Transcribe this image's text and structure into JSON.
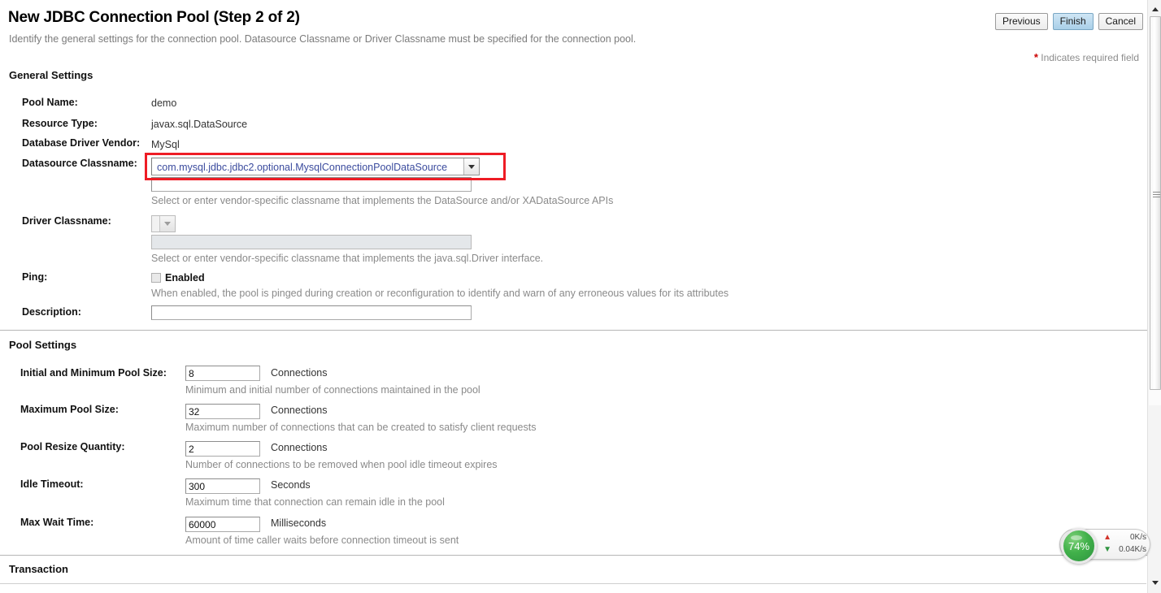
{
  "header": {
    "title": "New JDBC Connection Pool (Step 2 of 2)",
    "subtitle": "Identify the general settings for the connection pool. Datasource Classname or Driver Classname must be specified for the connection pool.",
    "required_star": "*",
    "required_note": "Indicates required field"
  },
  "buttons": {
    "previous": "Previous",
    "finish": "Finish",
    "cancel": "Cancel"
  },
  "sections": {
    "general": "General Settings",
    "pool": "Pool Settings",
    "transaction": "Transaction"
  },
  "general": {
    "pool_name_label": "Pool Name:",
    "pool_name_value": "demo",
    "resource_type_label": "Resource Type:",
    "resource_type_value": "javax.sql.DataSource",
    "vendor_label": "Database Driver Vendor:",
    "vendor_value": "MySql",
    "datasource_label": "Datasource Classname:",
    "datasource_selected": "com.mysql.jdbc.jdbc2.optional.MysqlConnectionPoolDataSource",
    "datasource_custom_value": "",
    "datasource_hint": "Select or enter vendor-specific classname that implements the DataSource and/or XADataSource APIs",
    "driver_label": "Driver Classname:",
    "driver_selected": "",
    "driver_custom_value": "",
    "driver_hint": "Select or enter vendor-specific classname that implements the java.sql.Driver interface.",
    "ping_label": "Ping:",
    "ping_checkbox_label": "Enabled",
    "ping_checked": false,
    "ping_hint": "When enabled, the pool is pinged during creation or reconfiguration to identify and warn of any erroneous values for its attributes",
    "description_label": "Description:",
    "description_value": ""
  },
  "pool": {
    "rows": [
      {
        "label": "Initial and Minimum Pool Size:",
        "value": "8",
        "unit": "Connections",
        "hint": "Minimum and initial number of connections maintained in the pool"
      },
      {
        "label": "Maximum Pool Size:",
        "value": "32",
        "unit": "Connections",
        "hint": "Maximum number of connections that can be created to satisfy client requests"
      },
      {
        "label": "Pool Resize Quantity:",
        "value": "2",
        "unit": "Connections",
        "hint": "Number of connections to be removed when pool idle timeout expires"
      },
      {
        "label": "Idle Timeout:",
        "value": "300",
        "unit": "Seconds",
        "hint": "Maximum time that connection can remain idle in the pool"
      },
      {
        "label": "Max Wait Time:",
        "value": "60000",
        "unit": "Milliseconds",
        "hint": "Amount of time caller waits before connection timeout is sent"
      }
    ]
  },
  "network_widget": {
    "percent": "74%",
    "upload": "0K/s",
    "download": "0.04K/s"
  },
  "colors": {
    "highlight_red": "#ee1c25",
    "required_red": "#cc0000",
    "primary_button": "#a9cfe8",
    "dial_green": "#41b14a",
    "link_blue": "#3b4b9e"
  }
}
